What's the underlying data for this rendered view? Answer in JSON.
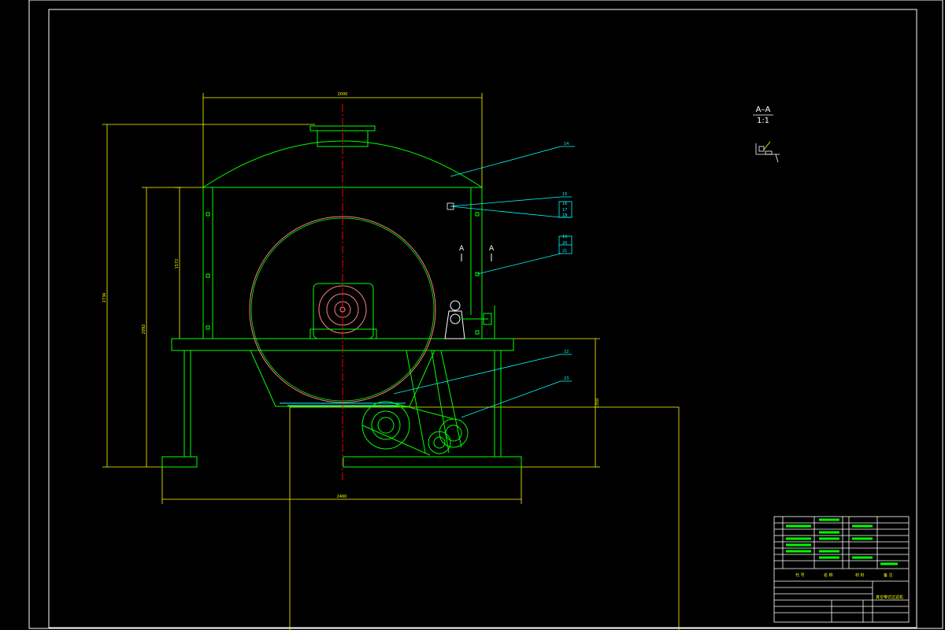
{
  "drawing": {
    "section_view": {
      "label": "A–A",
      "scale": "1:1",
      "cut_marker": "A"
    },
    "dimensions": {
      "top_width": "2000",
      "bottom_width": "2460",
      "overall_height": "2736",
      "body_height": "2092",
      "side_height_upper": "1572",
      "right_height": "1350"
    },
    "part_callouts": [
      "14",
      "15",
      "16",
      "17",
      "18",
      "19",
      "20",
      "21",
      "22",
      "23"
    ],
    "title_block": {
      "col_code": "代 号",
      "col_name": "名 称",
      "col_material": "材 料",
      "col_note": "备 注",
      "drawing_title": "真空带式过滤机"
    },
    "colors": {
      "frame": "#ffffff",
      "outline": "#00ff00",
      "dimension": "#ffff00",
      "leader": "#00ffff",
      "centerline": "#ff0000",
      "drum": "#ff8080"
    }
  }
}
